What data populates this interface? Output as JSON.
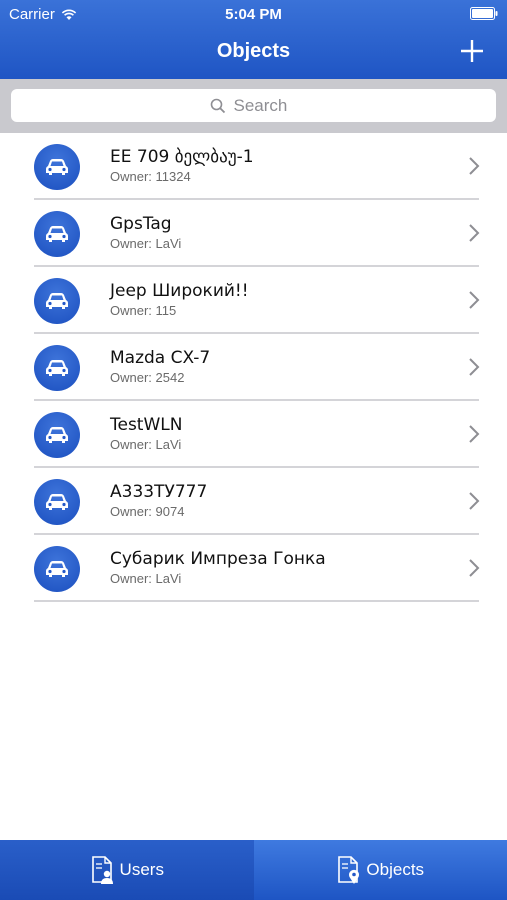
{
  "status": {
    "carrier": "Carrier",
    "time": "5:04 PM"
  },
  "nav": {
    "title": "Objects"
  },
  "search": {
    "placeholder": "Search"
  },
  "objects": [
    {
      "name": "EE 709 ბელბაუ-1",
      "owner": "Owner: 11324"
    },
    {
      "name": "GpsTag",
      "owner": "Owner: LaVi"
    },
    {
      "name": "Jeep Широкий!!",
      "owner": "Owner: 115"
    },
    {
      "name": "Mazda CX-7",
      "owner": "Owner: 2542"
    },
    {
      "name": "TestWLN",
      "owner": "Owner: LaVi"
    },
    {
      "name": "А333ТУ777",
      "owner": "Owner: 9074"
    },
    {
      "name": "Субарик Импреза Гонка",
      "owner": "Owner: LaVi"
    }
  ],
  "tabs": [
    {
      "label": "Users",
      "icon": "user-document-icon",
      "active": false
    },
    {
      "label": "Objects",
      "icon": "location-document-icon",
      "active": true
    }
  ],
  "colors": {
    "accent": "#2358c8",
    "search_bg": "#c9c9ce",
    "divider": "#d4d4d8"
  }
}
